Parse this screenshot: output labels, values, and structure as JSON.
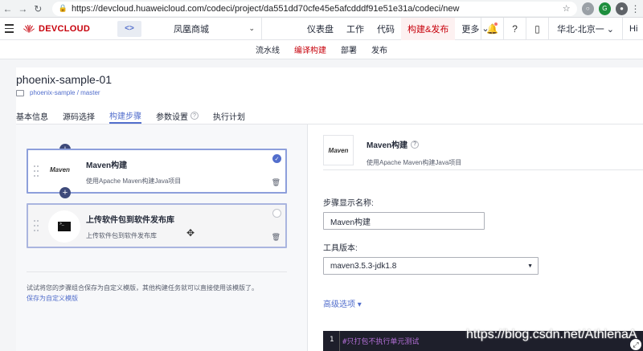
{
  "browser": {
    "url": "https://devcloud.huaweicloud.com/codeci/project/da551dd70cfe45e5afcdddf91e51e31a/codeci/new",
    "ext_g": "G"
  },
  "header": {
    "brand": "DEVCLOUD",
    "project_name": "凤凰商城",
    "nav": [
      "仪表盘",
      "工作",
      "代码",
      "构建&发布",
      "更多"
    ],
    "region": "华北-北京一",
    "user": "Hi"
  },
  "subnav": [
    "流水线",
    "编译构建",
    "部署",
    "发布"
  ],
  "pipeline": {
    "title": "phoenix-sample-01",
    "branch": "phoenix-sample / master",
    "tabs": [
      "基本信息",
      "源码选择",
      "构建步骤",
      "参数设置",
      "执行计划"
    ]
  },
  "steps": [
    {
      "logo": "Maven",
      "title": "Maven构建",
      "desc": "使用Apache Maven构建Java项目"
    },
    {
      "logo": "terminal",
      "title": "上传软件包到软件发布库",
      "desc": "上传软件包到软件发布库"
    }
  ],
  "template_hint": "试试将您的步骤组合保存为自定义模版，其他构建任务就可以直接使用该模版了。",
  "save_template": "保存为自定义模版",
  "detail": {
    "logo": "Maven",
    "title": "Maven构建",
    "desc": "使用Apache Maven构建Java项目",
    "name_label": "步骤显示名称:",
    "name_value": "Maven构建",
    "tool_label": "工具版本:",
    "tool_value": "maven3.5.3-jdk1.8",
    "advanced": "高级选项",
    "code_line_no": "1",
    "code_text": "#只打包不执行单元测试"
  },
  "watermark": "https://blog.csdn.net/AthlenaA",
  "colors": {
    "brand_red": "#c7000b",
    "accent_blue": "#526ecc"
  }
}
